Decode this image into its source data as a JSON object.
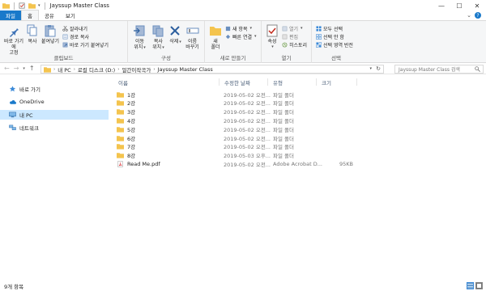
{
  "window": {
    "title": "Jayssup Master Class",
    "controls": [
      "—",
      "☐",
      "✕"
    ]
  },
  "ribbon_tabs": [
    "파일",
    "홈",
    "공유",
    "보기"
  ],
  "ribbon": {
    "clipboard": {
      "pin": [
        "바로 가기에",
        "고정"
      ],
      "copy": "복사",
      "paste": "붙여넣기",
      "cut": "잘라내기",
      "copy_path": "경로 복사",
      "paste_shortcut": "바로 가기 붙여넣기",
      "label": "클립보드"
    },
    "organize": {
      "move": [
        "이동",
        "위치"
      ],
      "copy_to": [
        "복사",
        "위치"
      ],
      "delete": "삭제",
      "rename": [
        "이름",
        "바꾸기"
      ],
      "label": "구성"
    },
    "new": {
      "new_folder": [
        "새",
        "폴더"
      ],
      "new_item": "새 항목",
      "easy_access": "빠른 연결",
      "label": "새로 만들기"
    },
    "open": {
      "properties": "속성",
      "open": "열기",
      "edit": "편집",
      "history": "히스토리",
      "label": "열기"
    },
    "select": {
      "select_all": "모두 선택",
      "select_none": "선택 안 함",
      "invert": "선택 영역 반전",
      "label": "선택"
    }
  },
  "address": {
    "crumbs": [
      "내 PC",
      "로컬 디스크 (D:)",
      "얼간이작곡가",
      "Jayssup Master Class"
    ],
    "search_placeholder": "Jayssup Master Class 검색"
  },
  "nav_pane": [
    {
      "label": "바로 가기",
      "icon": "star-icon",
      "selected": false
    },
    {
      "label": "OneDrive",
      "icon": "cloud-icon",
      "selected": false
    },
    {
      "label": "내 PC",
      "icon": "computer-icon",
      "selected": true
    },
    {
      "label": "네트워크",
      "icon": "network-icon",
      "selected": false
    }
  ],
  "columns": [
    "이름",
    "수정한 날짜",
    "유형",
    "크기"
  ],
  "files": [
    {
      "name": "1강",
      "date": "2019-05-02 오전...",
      "type": "파일 폴더",
      "size": "",
      "icon": "folder-icon"
    },
    {
      "name": "2강",
      "date": "2019-05-02 오전...",
      "type": "파일 폴더",
      "size": "",
      "icon": "folder-icon"
    },
    {
      "name": "3강",
      "date": "2019-05-02 오전...",
      "type": "파일 폴더",
      "size": "",
      "icon": "folder-icon"
    },
    {
      "name": "4강",
      "date": "2019-05-02 오전...",
      "type": "파일 폴더",
      "size": "",
      "icon": "folder-icon"
    },
    {
      "name": "5강",
      "date": "2019-05-02 오전...",
      "type": "파일 폴더",
      "size": "",
      "icon": "folder-icon"
    },
    {
      "name": "6강",
      "date": "2019-05-02 오전...",
      "type": "파일 폴더",
      "size": "",
      "icon": "folder-icon"
    },
    {
      "name": "7강",
      "date": "2019-05-02 오전...",
      "type": "파일 폴더",
      "size": "",
      "icon": "folder-icon"
    },
    {
      "name": "8강",
      "date": "2019-05-03 오후...",
      "type": "파일 폴더",
      "size": "",
      "icon": "folder-icon"
    },
    {
      "name": "Read Me.pdf",
      "date": "2019-05-02 오전...",
      "type": "Adobe Acrobat D...",
      "size": "95KB",
      "icon": "pdf-icon"
    }
  ],
  "status": {
    "item_count": "9개 항목"
  },
  "colors": {
    "file_tab": "#1979ca",
    "folder": "#f4c44e",
    "selection": "#cce8ff",
    "pdf": "#d9252a"
  }
}
